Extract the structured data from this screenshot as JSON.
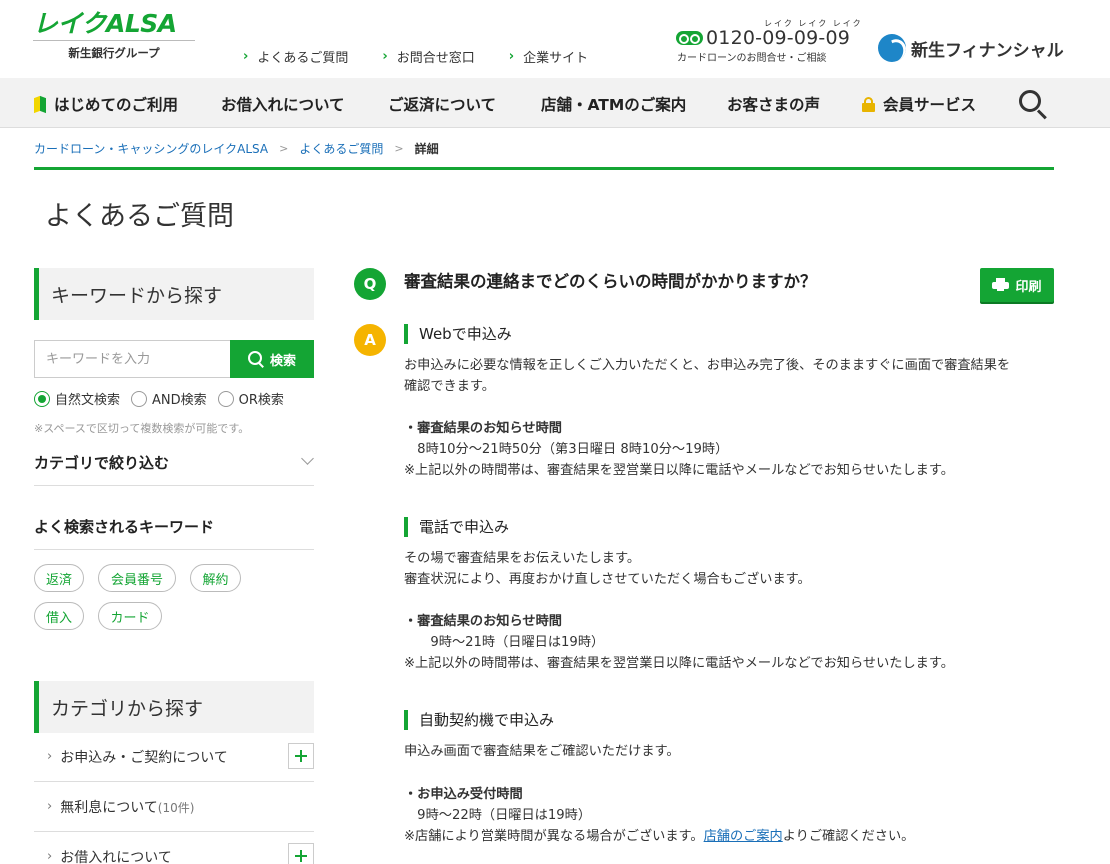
{
  "header": {
    "logo_main": "レイクALSA",
    "logo_sub": "新生銀行グループ",
    "links": [
      "よくあるご質問",
      "お問合せ窓口",
      "企業サイト"
    ],
    "phone_ruby": "レイク レイク レイク",
    "phone_number": "0120-09-09-09",
    "phone_note": "カードローンのお問合せ・ご相談",
    "group_name": "新生フィナンシャル"
  },
  "nav": {
    "items": [
      "はじめてのご利用",
      "お借入れについて",
      "ご返済について",
      "店舗・ATMのご案内",
      "お客さまの声",
      "会員サービス"
    ]
  },
  "breadcrumb": {
    "home": "カードローン・キャッシングのレイクALSA",
    "faq": "よくあるご質問",
    "current": "詳細"
  },
  "page_title": "よくあるご質問",
  "sidebar": {
    "keyword_head": "キーワードから探す",
    "search_placeholder": "キーワードを入力",
    "search_button": "検索",
    "radio_options": [
      "自然文検索",
      "AND検索",
      "OR検索"
    ],
    "search_note": "※スペースで区切って複数検索が可能です。",
    "category_filter": "カテゴリで絞り込む",
    "popular_head": "よく検索されるキーワード",
    "tags": [
      "返済",
      "会員番号",
      "解約",
      "借入",
      "カード"
    ],
    "category_head": "カテゴリから探す",
    "categories": [
      {
        "label": "お申込み・ご契約について",
        "count": ""
      },
      {
        "label": "無利息について",
        "count": "(10件)"
      },
      {
        "label": "お借入れについて",
        "count": ""
      }
    ]
  },
  "qa": {
    "q_mark": "Q",
    "a_mark": "A",
    "question": "審査結果の連絡までどのくらいの時間がかかりますか？",
    "print_label": "印刷",
    "sections": [
      {
        "head": "Webで申込み",
        "lines": [
          "お申込みに必要な情報を正しくご入力いただくと、お申込み完了後、そのまますぐに画面で審査結果を",
          "確認できます。",
          "・審査結果のお知らせ時間",
          "　8時10分～21時50分（第3日曜日 8時10分～19時）",
          "※上記以外の時間帯は、審査結果を翌営業日以降に電話やメールなどでお知らせいたします。"
        ]
      },
      {
        "head": "電話で申込み",
        "lines": [
          "その場で審査結果をお伝えいたします。",
          "審査状況により、再度おかけ直しさせていただく場合もございます。",
          "・審査結果のお知らせ時間",
          "　　9時～21時（日曜日は19時）",
          "※上記以外の時間帯は、審査結果を翌営業日以降に電話やメールなどでお知らせいたします。"
        ]
      },
      {
        "head": "自動契約機で申込み",
        "lines": [
          "申込み画面で審査結果をご確認いただけます。",
          "・お申込み受付時間",
          "　9時～22時（日曜日は19時）",
          "※店舗により営業時間が異なる場合がございます。",
          "店舗のご案内",
          "よりご確認ください。"
        ]
      }
    ]
  },
  "colors": {
    "brand_green": "#14a534",
    "answer_orange": "#f5b400",
    "link_blue": "#1a6fb8"
  }
}
